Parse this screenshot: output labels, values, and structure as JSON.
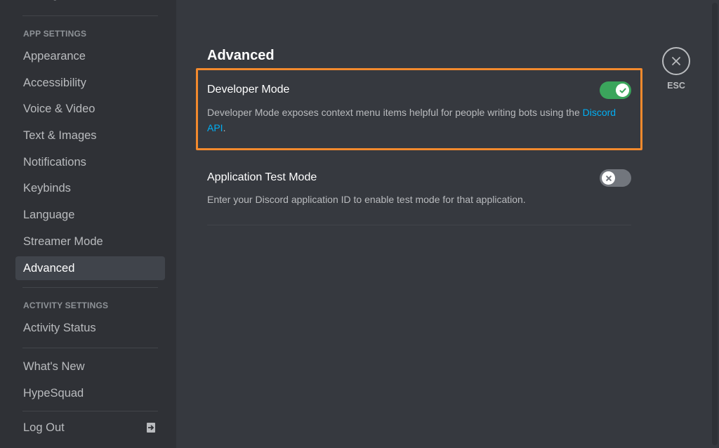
{
  "sidebar": {
    "cut_item": "Settings",
    "sections": [
      {
        "header": "App Settings",
        "items": [
          {
            "label": "Appearance"
          },
          {
            "label": "Accessibility"
          },
          {
            "label": "Voice & Video"
          },
          {
            "label": "Text & Images"
          },
          {
            "label": "Notifications"
          },
          {
            "label": "Keybinds"
          },
          {
            "label": "Language"
          },
          {
            "label": "Streamer Mode"
          },
          {
            "label": "Advanced",
            "active": true
          }
        ]
      },
      {
        "header": "Activity Settings",
        "items": [
          {
            "label": "Activity Status"
          }
        ]
      }
    ],
    "misc_items": [
      {
        "label": "What's New"
      },
      {
        "label": "HypeSquad"
      }
    ],
    "logout": {
      "label": "Log Out",
      "icon": "logout-icon"
    }
  },
  "main": {
    "title": "Advanced",
    "settings": [
      {
        "title": "Developer Mode",
        "description_prefix": "Developer Mode exposes context menu items helpful for people writing bots using the ",
        "link_text": "Discord API",
        "description_suffix": ".",
        "enabled": true,
        "highlighted": true
      },
      {
        "title": "Application Test Mode",
        "description": "Enter your Discord application ID to enable test mode for that application.",
        "enabled": false
      }
    ],
    "close": {
      "label": "ESC",
      "icon": "close-icon"
    }
  },
  "colors": {
    "accent_link": "#00aff4",
    "toggle_on": "#3ba55c",
    "toggle_off": "#72767d",
    "highlight_border": "#f38a2d"
  }
}
